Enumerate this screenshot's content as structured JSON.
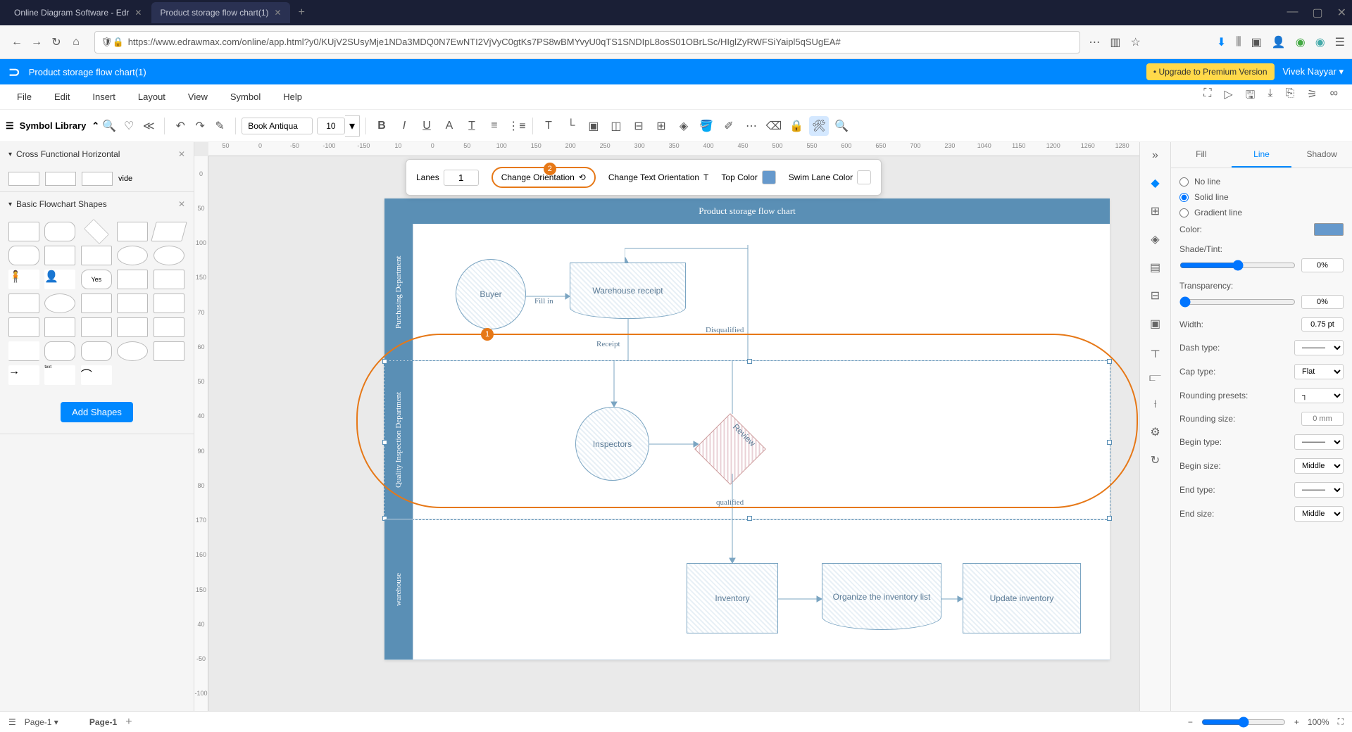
{
  "browser": {
    "tabs": [
      {
        "title": "Online Diagram Software - Edr",
        "active": false
      },
      {
        "title": "Product storage flow chart(1)",
        "active": true
      }
    ],
    "url": "https://www.edrawmax.com/online/app.html?y0/KUjV2SUsyMje1NDa3MDQ0N7EwNTI2VjVyC0gtKs7PS8wBMYvyU0qTS1SNDIpL8osS01OBrLSc/HIglZyRWFSiYaipl5qSUgEA#"
  },
  "header": {
    "doc_title": "Product storage flow chart(1)",
    "upgrade": "• Upgrade to Premium Version",
    "user": "Vivek Nayyar"
  },
  "menu": {
    "items": [
      "File",
      "Edit",
      "Insert",
      "Layout",
      "View",
      "Symbol",
      "Help"
    ]
  },
  "toolbar": {
    "symbol_library": "Symbol Library",
    "font": "Book Antiqua",
    "font_size": "10"
  },
  "context": {
    "lanes_label": "Lanes",
    "lanes_value": "1",
    "change_orientation": "Change Orientation",
    "change_text_orientation": "Change Text Orientation",
    "top_color": "Top Color",
    "swimlane_color": "Swim Lane Color",
    "badge2": "2",
    "badge1": "1"
  },
  "sidebar": {
    "section1": "Cross Functional Horizontal",
    "section2": "Basic Flowchart Shapes",
    "vide": "vide",
    "add_shapes": "Add Shapes"
  },
  "diagram": {
    "title": "Product storage flow chart",
    "lane1": "Purchasing Department",
    "lane2": "Quality Inspection Department",
    "lane3": "warehouse",
    "buyer": "Buyer",
    "fill_in": "Fill in",
    "warehouse_receipt": "Warehouse receipt",
    "receipt": "Receipt",
    "disqualified": "Disqualified",
    "inspectors": "Inspectors",
    "review": "Review",
    "qualified": "qualified",
    "inventory": "Inventory",
    "organize": "Organize the inventory list",
    "update": "Update inventory"
  },
  "right": {
    "tabs": [
      "Fill",
      "Line",
      "Shadow"
    ],
    "no_line": "No line",
    "solid_line": "Solid line",
    "gradient_line": "Gradient line",
    "color": "Color:",
    "shade_tint": "Shade/Tint:",
    "shade_val": "0%",
    "transparency": "Transparency:",
    "trans_val": "0%",
    "width": "Width:",
    "width_val": "0.75 pt",
    "dash_type": "Dash type:",
    "cap_type": "Cap type:",
    "cap_val": "Flat",
    "rounding_presets": "Rounding presets:",
    "rounding_size": "Rounding size:",
    "rounding_val": "0 mm",
    "begin_type": "Begin type:",
    "begin_size": "Begin size:",
    "begin_size_val": "Middle",
    "end_type": "End type:",
    "end_size": "End size:",
    "end_size_val": "Middle"
  },
  "status": {
    "page_dropdown": "Page-1",
    "page_tab": "Page-1",
    "zoom": "100%"
  },
  "ruler_h": [
    "50",
    "0",
    "-50",
    "-100",
    "-150",
    "10",
    "0",
    "50",
    "100",
    "150",
    "200",
    "250",
    "300",
    "350",
    "400",
    "450",
    "500",
    "550",
    "600",
    "650",
    "700",
    "230",
    "1040",
    "1150",
    "1200",
    "1260",
    "1280"
  ],
  "ruler_v": [
    "0",
    "50",
    "100",
    "150",
    "70",
    "60",
    "50",
    "40",
    "90",
    "80",
    "170",
    "160",
    "150",
    "40",
    "-50",
    "-100"
  ]
}
